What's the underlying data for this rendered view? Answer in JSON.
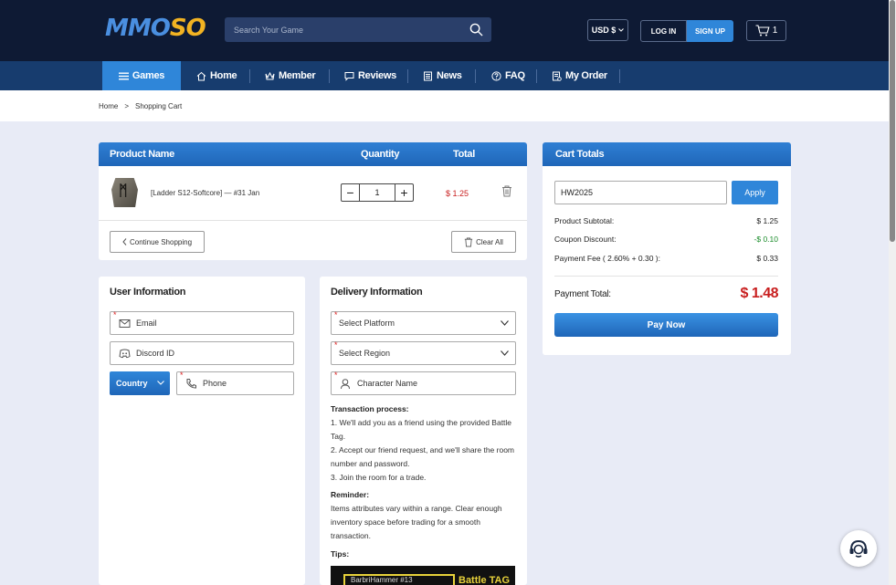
{
  "header": {
    "logo_part1": "MMO",
    "logo_part2": "SO",
    "search_placeholder": "Search Your Game",
    "currency": "USD $",
    "login": "LOG IN",
    "signup": "SIGN UP",
    "cart_count": "1"
  },
  "nav": {
    "games": "Games",
    "home": "Home",
    "member": "Member",
    "reviews": "Reviews",
    "news": "News",
    "faq": "FAQ",
    "my_order": "My Order"
  },
  "breadcrumb": {
    "home": "Home",
    "sep": ">",
    "current": "Shopping Cart"
  },
  "cart_table": {
    "col_product": "Product Name",
    "col_quantity": "Quantity",
    "col_total": "Total",
    "item": {
      "name": "[Ladder S12-Softcore] — #31 Jan",
      "quantity": "1",
      "price": "$ 1.25"
    },
    "continue_shopping": "Continue Shopping",
    "clear_all": "Clear All"
  },
  "user_info": {
    "title": "User Information",
    "email_placeholder": "Email",
    "discord_placeholder": "Discord ID",
    "country": "Country",
    "phone_placeholder": "Phone"
  },
  "delivery": {
    "title": "Delivery Information",
    "platform": "Select Platform",
    "region": "Select Region",
    "character_placeholder": "Character Name",
    "process_title": "Transaction process:",
    "step1": "1. We'll add you as a friend using the provided Battle Tag.",
    "step2": "2. Accept our friend request, and we'll share the room number and password.",
    "step3": "3. Join the room for a trade.",
    "reminder_title": "Reminder:",
    "reminder": "Items attributes vary within a range. Clear enough inventory space before trading for a smooth transaction.",
    "tips_title": "Tips:",
    "banner_text1": "BarbriHammer #13",
    "banner_text2": "Battle TAG"
  },
  "cart_totals": {
    "title": "Cart Totals",
    "coupon_value": "HW2025",
    "apply": "Apply",
    "subtotal_label": "Product Subtotal:",
    "subtotal_value": "$ 1.25",
    "discount_label": "Coupon Discount:",
    "discount_value": "-$ 0.10",
    "fee_label": "Payment Fee ( 2.60% + 0.30 ):",
    "fee_value": "$ 0.33",
    "total_label": "Payment Total:",
    "total_value": "$ 1.48",
    "pay_now": "Pay Now"
  }
}
